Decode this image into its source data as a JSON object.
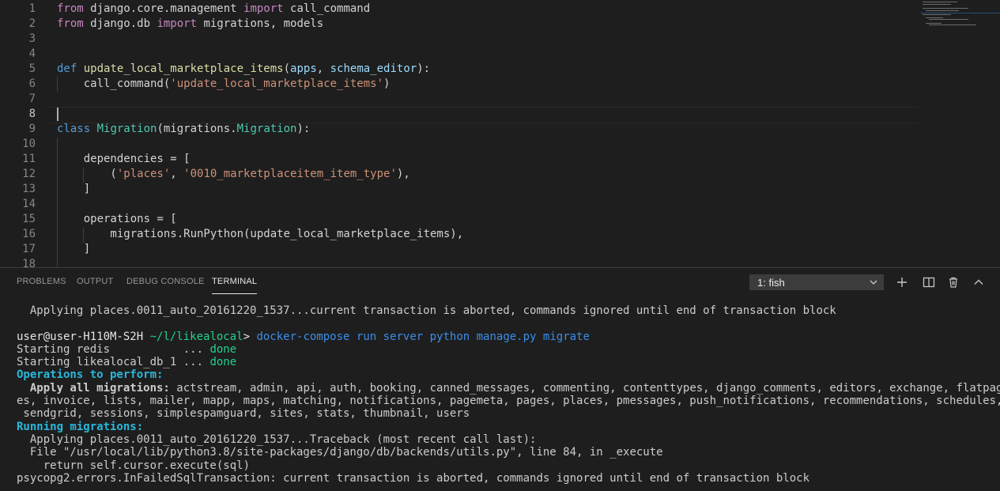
{
  "editor": {
    "line_numbers": [
      "1",
      "2",
      "3",
      "4",
      "5",
      "6",
      "7",
      "8",
      "9",
      "10",
      "11",
      "12",
      "13",
      "14",
      "15",
      "16",
      "17",
      "18"
    ],
    "code": {
      "l1_kw1": "from",
      "l1_mod": " django.core.management ",
      "l1_kw2": "import",
      "l1_name": " call_command",
      "l2_kw1": "from",
      "l2_mod": " django.db ",
      "l2_kw2": "import",
      "l2_name": " migrations, models",
      "l5_def": "def",
      "l5_fn": " update_local_marketplace_items",
      "l5_open": "(",
      "l5_p1": "apps",
      "l5_comma": ", ",
      "l5_p2": "schema_editor",
      "l5_close": "):",
      "l6_pre": "    call_command(",
      "l6_str": "'update_local_marketplace_items'",
      "l6_post": ")",
      "l9_kw": "class",
      "l9_space": " ",
      "l9_cls": "Migration",
      "l9_open": "(migrations.",
      "l9_base": "Migration",
      "l9_close": "):",
      "l11": "    dependencies = [",
      "l12_pre": "        (",
      "l12_s1": "'places'",
      "l12_mid": ", ",
      "l12_s2": "'0010_marketplaceitem_item_type'",
      "l12_post": "),",
      "l13": "    ]",
      "l15": "    operations = [",
      "l16": "        migrations.RunPython(update_local_marketplace_items),",
      "l17": "    ]"
    }
  },
  "panel": {
    "tabs": [
      "PROBLEMS",
      "OUTPUT",
      "DEBUG CONSOLE",
      "TERMINAL"
    ],
    "active_tab": "TERMINAL",
    "terminal_select": "1: fish",
    "icons": [
      "add-icon",
      "split-icon",
      "trash-icon",
      "chevron-up-icon"
    ]
  },
  "terminal": {
    "line_prev": "  Applying places.0011_auto_20161220_1537...current transaction is aborted, commands ignored until end of transaction block",
    "prompt_user": "user@user-H110M-S2H",
    "prompt_path": " ~/l/likealocal",
    "prompt_gt": "> ",
    "cmd1": "docker-compose",
    "cmd2": " run server python manage.py migrate",
    "start_redis": "Starting redis           ... ",
    "start_db": "Starting likealocal_db_1 ... ",
    "done": "done",
    "ops_header": "Operations to perform:",
    "apply_label": "  Apply all migrations:",
    "apply_list_1": " actstream, admin, api, auth, booking, canned_messages, commenting, contenttypes, django_comments, editors, exchange, flatpag",
    "apply_list_2": "es, invoice, lists, mailer, mapp, maps, matching, notifications, pagemeta, pages, places, pmessages, push_notifications, recommendations, schedules,",
    "apply_list_3": " sendgrid, sessions, simplespamguard, sites, stats, thumbnail, users",
    "running": "Running migrations:",
    "applying": "  Applying places.0011_auto_20161220_1537...Traceback (most recent call last):",
    "file_line": "  File \"/usr/local/lib/python3.8/site-packages/django/db/backends/utils.py\", line 84, in _execute",
    "return_line": "    return self.cursor.execute(sql)",
    "error_line": "psycopg2.errors.InFailedSqlTransaction: current transaction is aborted, commands ignored until end of transaction block"
  }
}
